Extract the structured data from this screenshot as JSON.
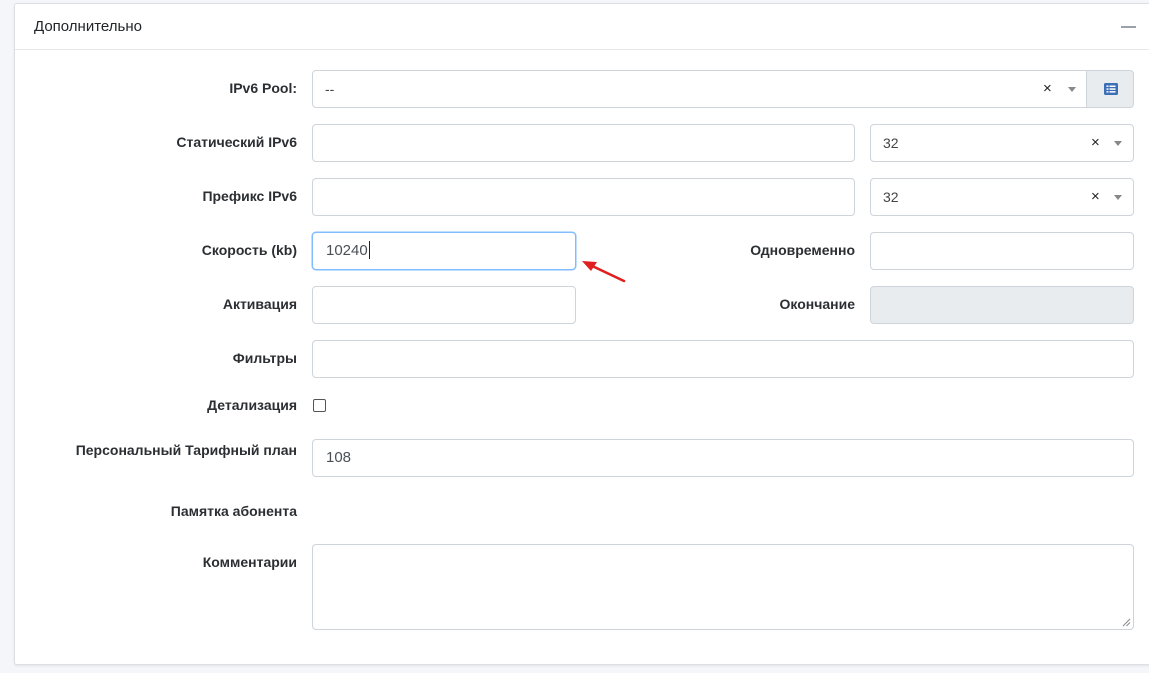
{
  "panel": {
    "title": "Дополнительно"
  },
  "fields": {
    "ipv6_pool": {
      "label": "IPv6 Pool:",
      "value": "--"
    },
    "static_ipv6": {
      "label": "Статический IPv6",
      "value": "",
      "prefix_len": "32"
    },
    "ipv6_prefix": {
      "label": "Префикс IPv6",
      "value": "",
      "prefix_len": "32"
    },
    "speed": {
      "label": "Скорость (kb)",
      "value": "10240"
    },
    "simultaneous": {
      "label": "Одновременно",
      "value": ""
    },
    "activation": {
      "label": "Активация",
      "value": ""
    },
    "expiration": {
      "label": "Окончание",
      "value": ""
    },
    "filters": {
      "label": "Фильтры",
      "value": ""
    },
    "detailing": {
      "label": "Детализация",
      "checked": false
    },
    "personal_tariff": {
      "label": "Персональный Тарифный план",
      "value": "108"
    },
    "subscriber_memo": {
      "label": "Памятка абонента"
    },
    "comments": {
      "label": "Комментарии",
      "value": ""
    }
  },
  "icons": {
    "clear": "×",
    "dropdown": "chevron-down-icon",
    "list": "list-icon",
    "collapse": "minus-icon"
  },
  "colors": {
    "annotation_arrow": "#e02020",
    "list_icon": "#3c6fb5",
    "focus_border": "#80bdff"
  }
}
